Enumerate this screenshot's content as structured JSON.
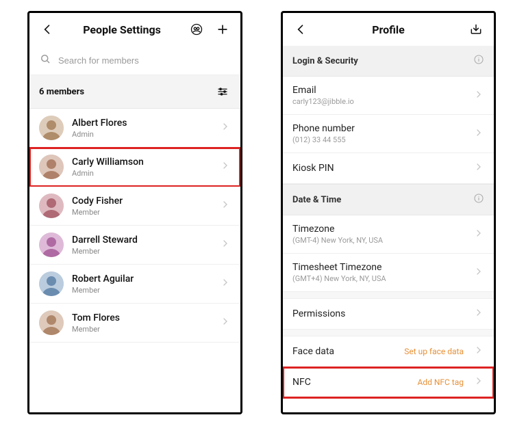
{
  "left": {
    "title": "People Settings",
    "search_placeholder": "Search for members",
    "count_label": "6 members",
    "members": [
      {
        "name": "Albert Flores",
        "role": "Admin",
        "highlight": false,
        "avatar_hue": 30
      },
      {
        "name": "Carly Williamson",
        "role": "Admin",
        "highlight": true,
        "avatar_hue": 20
      },
      {
        "name": "Cody Fisher",
        "role": "Member",
        "highlight": false,
        "avatar_hue": 350
      },
      {
        "name": "Darrell Steward",
        "role": "Member",
        "highlight": false,
        "avatar_hue": 310
      },
      {
        "name": "Robert Aguilar",
        "role": "Member",
        "highlight": false,
        "avatar_hue": 210
      },
      {
        "name": "Tom Flores",
        "role": "Member",
        "highlight": false,
        "avatar_hue": 25
      }
    ]
  },
  "right": {
    "title": "Profile",
    "sections": [
      {
        "heading": "Login & Security",
        "info_icon": true,
        "rows": [
          {
            "label": "Email",
            "sub": "carly123@jibble.io",
            "action": "",
            "highlight": false
          },
          {
            "label": "Phone number",
            "sub": "(012) 33 44 555",
            "action": "",
            "highlight": false
          },
          {
            "label": "Kiosk PIN",
            "sub": "",
            "action": "",
            "highlight": false
          }
        ]
      },
      {
        "heading": "Date & Time",
        "info_icon": true,
        "rows": [
          {
            "label": "Timezone",
            "sub": "(GMT-4) New York, NY, USA",
            "action": "",
            "highlight": false
          },
          {
            "label": "Timesheet Timezone",
            "sub": "(GMT+4) New York, NY, USA",
            "action": "",
            "highlight": false
          }
        ]
      },
      {
        "heading": "",
        "rows": [
          {
            "label": "Permissions",
            "sub": "",
            "action": "",
            "highlight": false
          }
        ]
      },
      {
        "heading": "",
        "rows": [
          {
            "label": "Face data",
            "sub": "",
            "action": "Set up face data",
            "highlight": false
          },
          {
            "label": "NFC",
            "sub": "",
            "action": "Add NFC tag",
            "highlight": true
          }
        ]
      }
    ]
  }
}
